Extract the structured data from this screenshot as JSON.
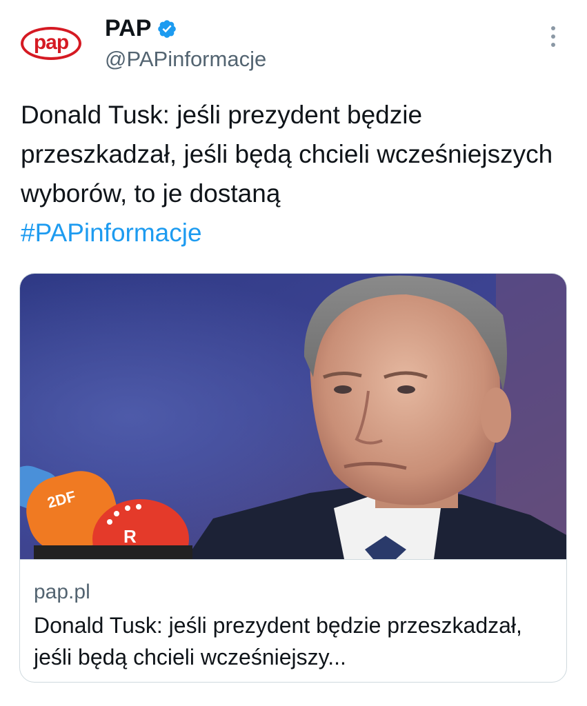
{
  "author": {
    "avatar_logo_text": "pap",
    "display_name": "PAP",
    "handle": "@PAPinformacje",
    "verified_icon": "verified-badge-icon",
    "brand_color": "#d51a23",
    "verified_color": "#1d9bf0"
  },
  "menu": {
    "icon": "more-vertical-icon"
  },
  "tweet": {
    "text": "Donald Tusk: jeśli prezydent będzie przeszkadzał, jeśli będą chcieli wcześniejszych wyborów, to je dostaną",
    "hashtag": "#PAPinformacje"
  },
  "link_card": {
    "image_alt": "Donald Tusk przed mikrofonami",
    "domain": "pap.pl",
    "title": "Donald Tusk: jeśli prezydent będzie przeszkadzał, jeśli będą chcieli wcześniejszy..."
  },
  "colors": {
    "text_primary": "#0f1419",
    "text_secondary": "#536471",
    "link": "#1d9bf0",
    "border": "#cfd9de"
  }
}
